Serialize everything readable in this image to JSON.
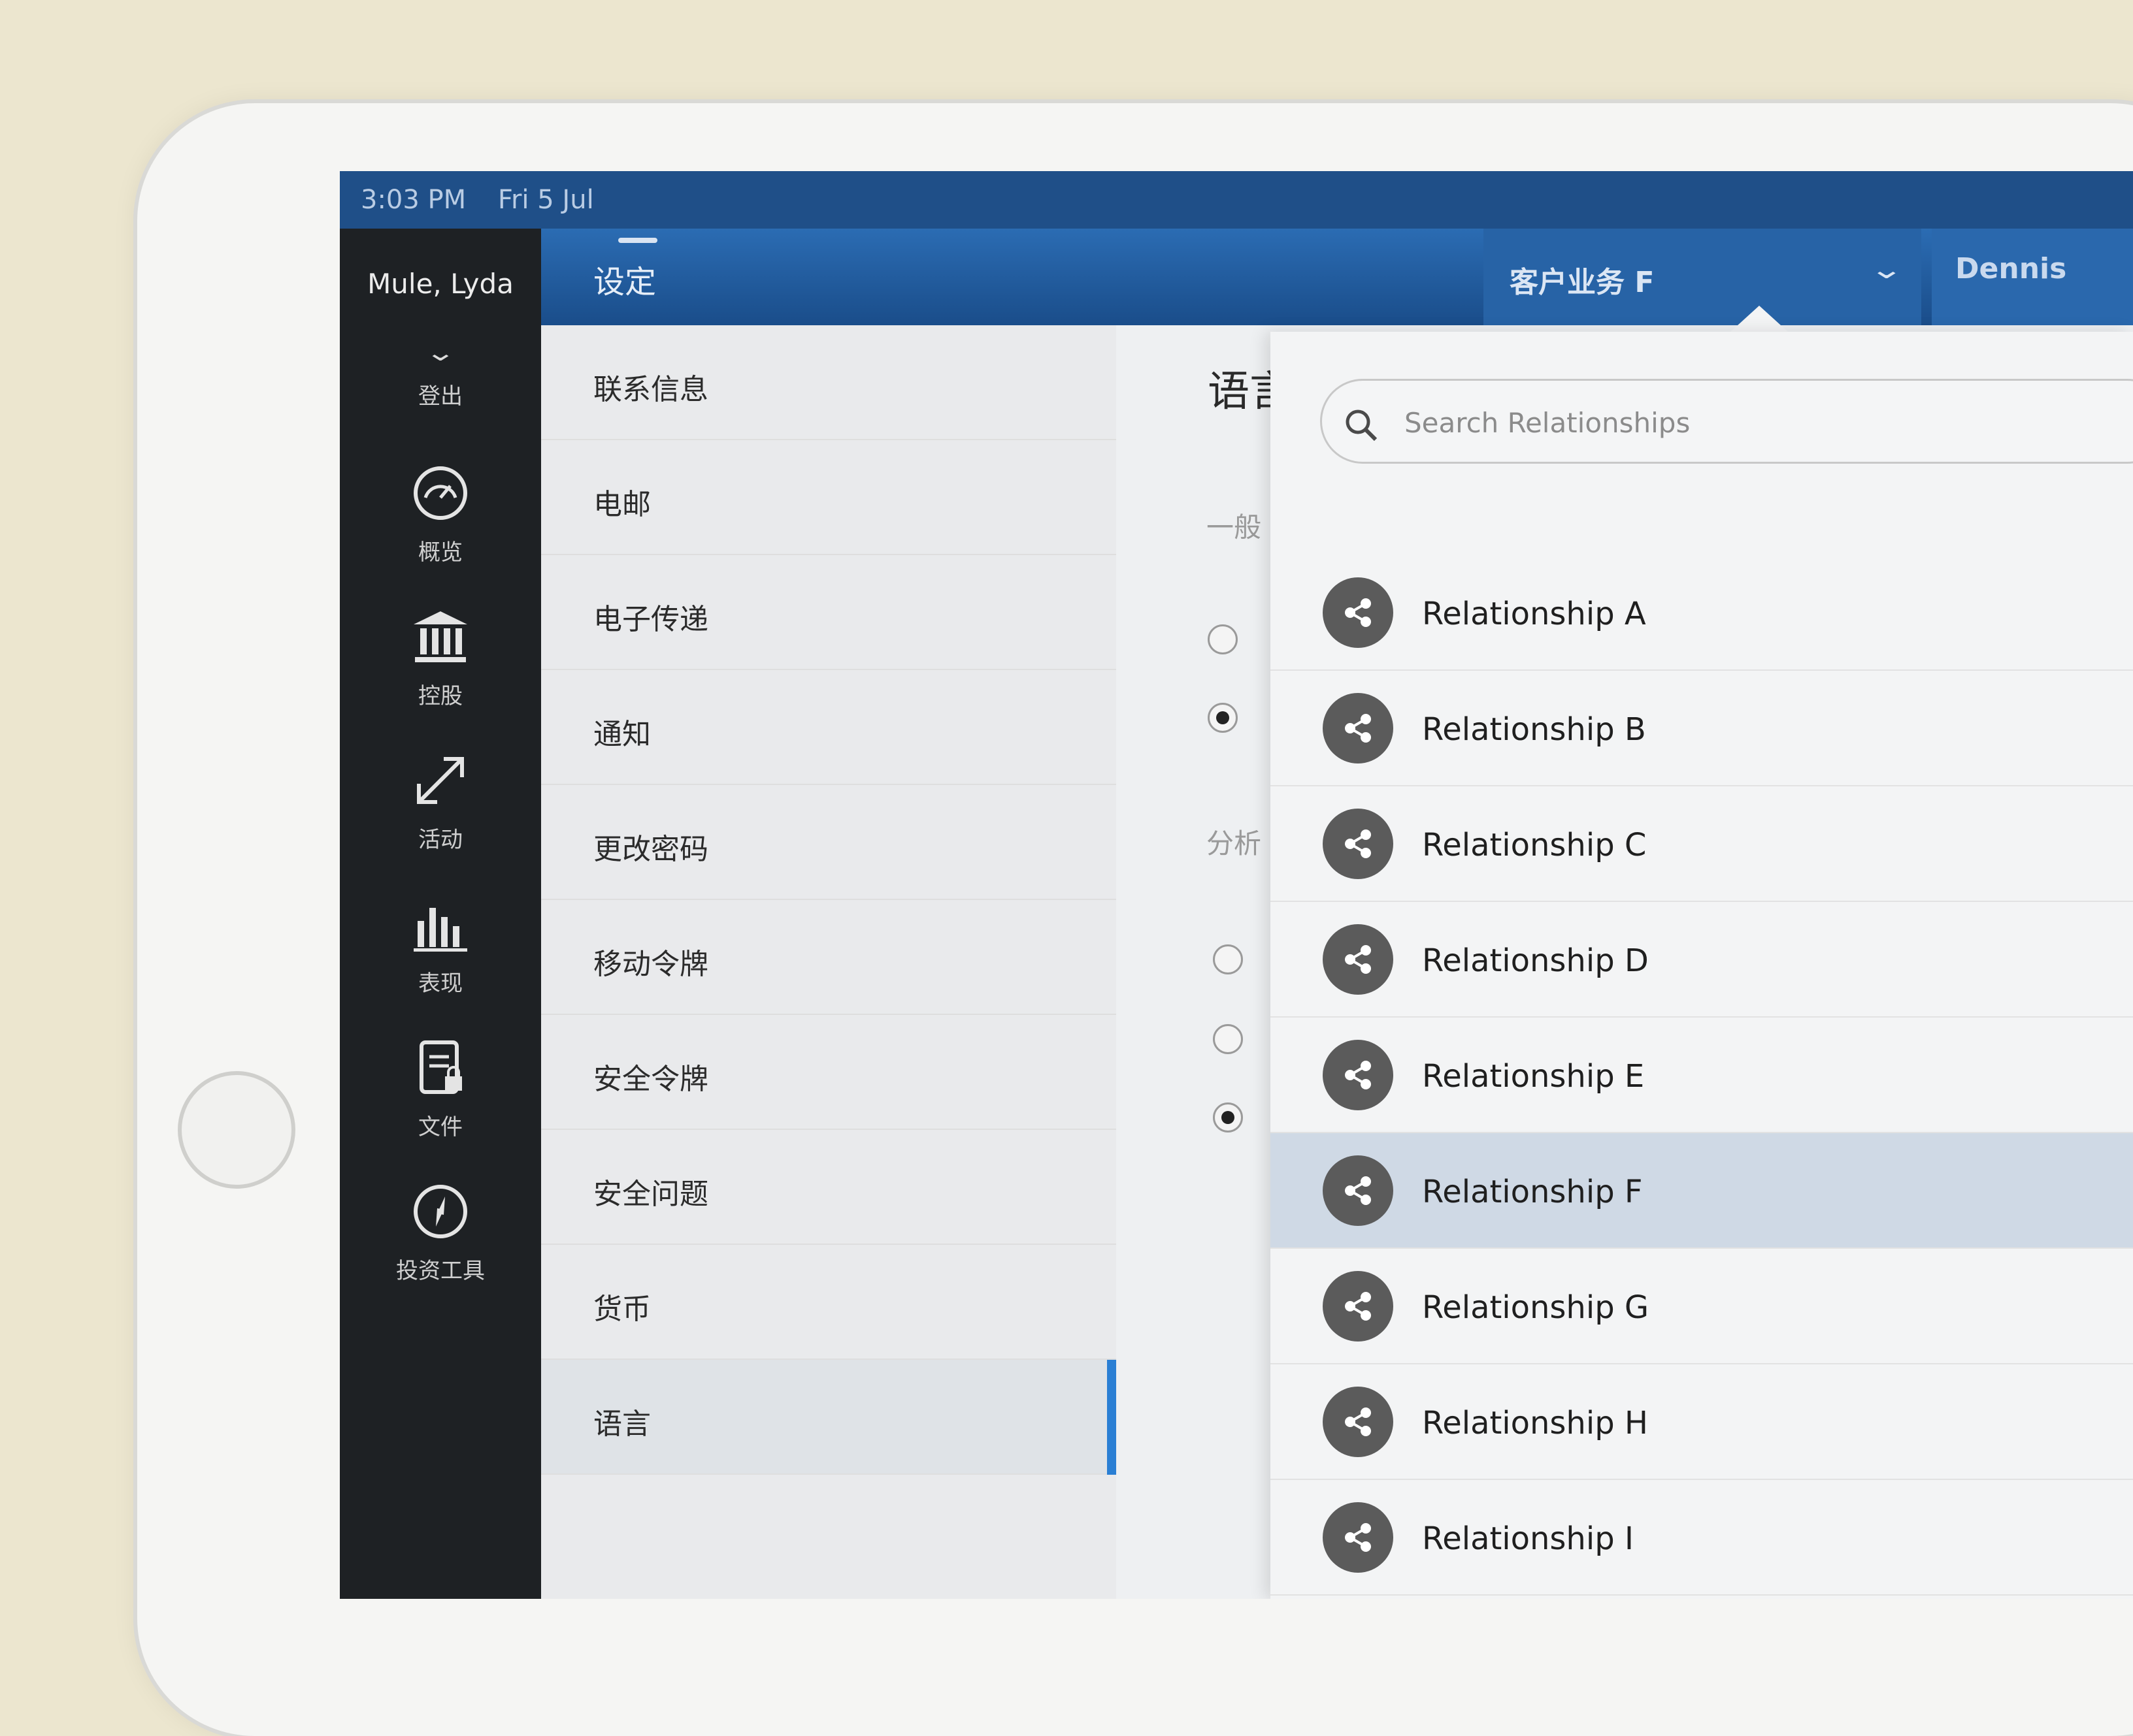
{
  "status_bar": {
    "time": "3:03 PM",
    "date": "Fri 5 Jul"
  },
  "sidebar": {
    "user_name": "Mule, Lyda",
    "logout_label": "登出",
    "items": [
      {
        "label": "概览",
        "icon": "gauge-icon"
      },
      {
        "label": "控股",
        "icon": "bank-icon"
      },
      {
        "label": "活动",
        "icon": "transfer-arrows-icon"
      },
      {
        "label": "表现",
        "icon": "bar-chart-icon"
      },
      {
        "label": "文件",
        "icon": "locked-document-icon"
      },
      {
        "label": "投资工具",
        "icon": "compass-icon"
      }
    ]
  },
  "header": {
    "title": "设定",
    "relationship_selector": "客户业务 F",
    "user_menu": "Dennis"
  },
  "settings_menu": {
    "items": [
      "联系信息",
      "电邮",
      "电子传递",
      "通知",
      "更改密码",
      "移动令牌",
      "安全令牌",
      "安全问题",
      "货币",
      "语言"
    ],
    "selected": "语言"
  },
  "detail": {
    "title": "语言",
    "section_general": "一般",
    "section_analysis": "分析"
  },
  "relationship_popover": {
    "search_placeholder": "Search Relationships",
    "items": [
      "Relationship A",
      "Relationship B",
      "Relationship C",
      "Relationship D",
      "Relationship E",
      "Relationship F",
      "Relationship G",
      "Relationship H",
      "Relationship I"
    ],
    "selected": "Relationship F",
    "colors": {
      "icon_bg": "#5b5b5b",
      "selected_row": "#cfd9e5"
    }
  },
  "colors": {
    "header": "#2a6ab0",
    "sidebar": "#1e2124",
    "accent": "#2a7fd4"
  }
}
